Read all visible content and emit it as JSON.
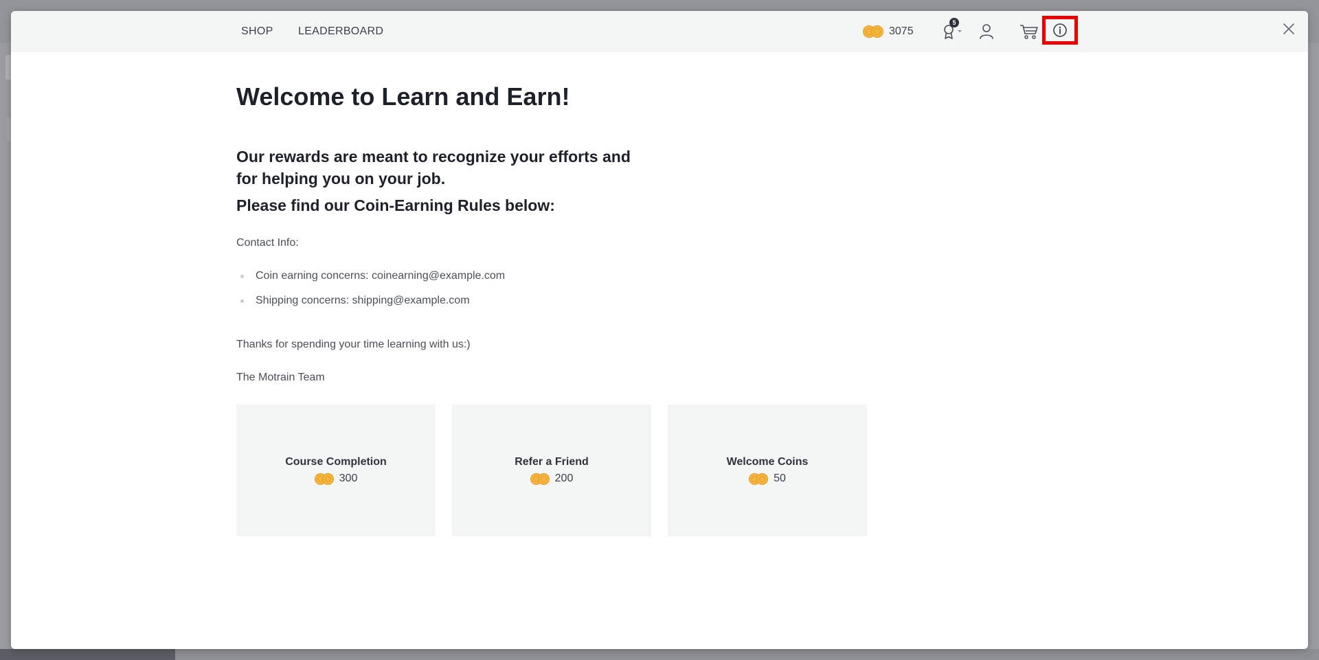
{
  "nav": {
    "shop_label": "SHOP",
    "leaderboard_label": "LEADERBOARD"
  },
  "header": {
    "coin_balance": "3075",
    "badge_count": "5",
    "icons": {
      "coins": "coins-icon",
      "badge": "award-ribbon-icon",
      "user": "user-icon",
      "cart": "cart-icon",
      "info": "info-icon",
      "close": "close-icon"
    }
  },
  "main": {
    "title": "Welcome to Learn and Earn!",
    "intro": "Our rewards are meant to recognize your efforts and for helping you on your job.",
    "rules_heading": "Please find our Coin-Earning Rules below:",
    "contact_label": "Contact Info:",
    "contacts": [
      "Coin earning concerns: coinearning@example.com",
      "Shipping concerns: shipping@example.com"
    ],
    "thanks": "Thanks for spending your time learning with us:)",
    "signoff": "The Motrain Team"
  },
  "rules": [
    {
      "title": "Course Completion",
      "amount": "300"
    },
    {
      "title": "Refer a Friend",
      "amount": "200"
    },
    {
      "title": "Welcome Coins",
      "amount": "50"
    }
  ],
  "colors": {
    "coin": "#f5b63f",
    "highlight": "#ee0000",
    "heading": "#1d212a",
    "topbar": "#f4f5f5"
  }
}
